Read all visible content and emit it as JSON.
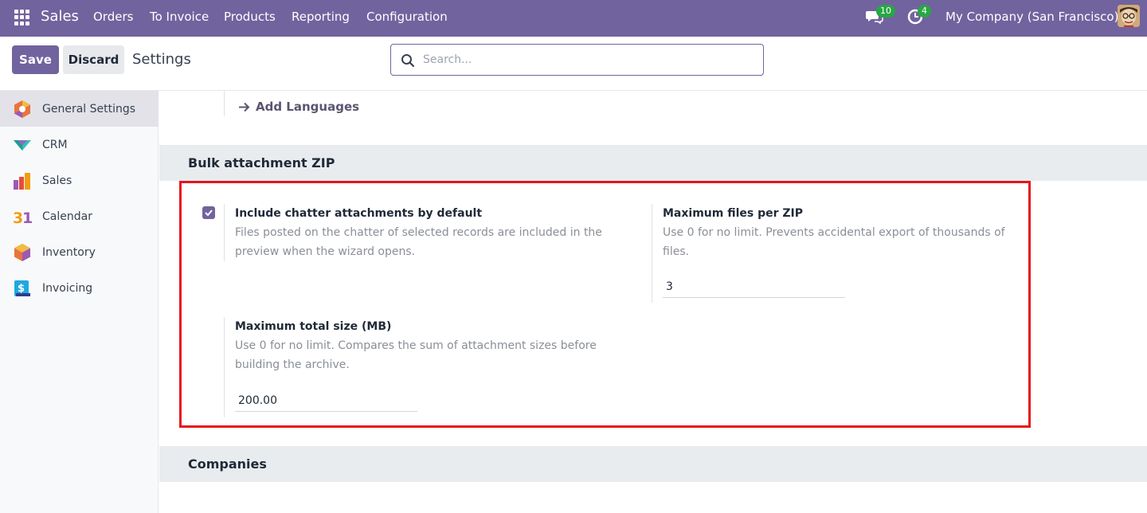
{
  "navbar": {
    "app_name": "Sales",
    "menu": [
      "Orders",
      "To Invoice",
      "Products",
      "Reporting",
      "Configuration"
    ],
    "chat_count": "10",
    "activity_count": "4",
    "company": "My Company (San Francisco)"
  },
  "control": {
    "save_label": "Save",
    "discard_label": "Discard",
    "title": "Settings",
    "search_placeholder": "Search..."
  },
  "sidebar": {
    "items": [
      {
        "label": "General Settings",
        "icon": "general-settings-icon"
      },
      {
        "label": "CRM",
        "icon": "crm-icon"
      },
      {
        "label": "Sales",
        "icon": "sales-icon"
      },
      {
        "label": "Calendar",
        "icon": "calendar-icon"
      },
      {
        "label": "Inventory",
        "icon": "inventory-icon"
      },
      {
        "label": "Invoicing",
        "icon": "invoicing-icon"
      }
    ]
  },
  "main": {
    "add_languages": "Add Languages",
    "bulk_section": "Bulk attachment ZIP",
    "include_chatter": {
      "title": "Include chatter attachments by default",
      "desc": "Files posted on the chatter of selected records are included in the preview when the wizard opens.",
      "checked": true
    },
    "max_files": {
      "title": "Maximum files per ZIP",
      "desc": "Use 0 for no limit. Prevents accidental export of thousands of files.",
      "value": "3"
    },
    "max_size": {
      "title": "Maximum total size (MB)",
      "desc": "Use 0 for no limit. Compares the sum of attachment sizes before building the archive.",
      "value": "200.00"
    },
    "companies_section": "Companies"
  },
  "colors": {
    "brand": "#71639e",
    "badge": "#28a745",
    "highlight": "#e5151e"
  }
}
